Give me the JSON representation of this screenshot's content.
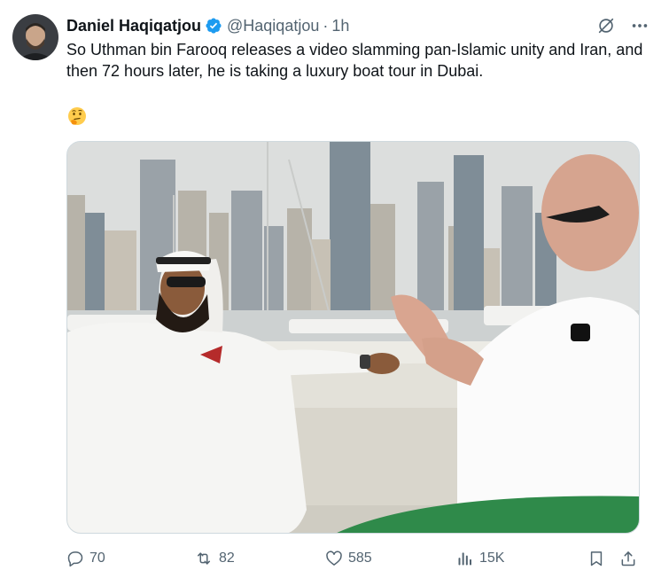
{
  "author": {
    "display_name": "Daniel Haqiqatjou",
    "handle": "@Haqiqatjou",
    "separator": "·",
    "time": "1h",
    "verified": true
  },
  "tweet": {
    "text": "So Uthman bin Farooq releases a video slamming pan-Islamic unity and Iran, and then 72 hours later, he is taking a luxury boat tour in Dubai.",
    "emoji": "thinking-face"
  },
  "metrics": {
    "replies": "70",
    "reposts": "82",
    "likes": "585",
    "views": "15K"
  },
  "icons": {
    "top": [
      "grok-icon",
      "more-icon"
    ],
    "actions": [
      "reply-icon",
      "repost-icon",
      "like-icon",
      "views-icon",
      "bookmark-icon",
      "share-icon"
    ]
  },
  "colors": {
    "text": "#0f1419",
    "muted": "#536471",
    "verified": "#1d9bf0",
    "border": "#cfd9de"
  }
}
